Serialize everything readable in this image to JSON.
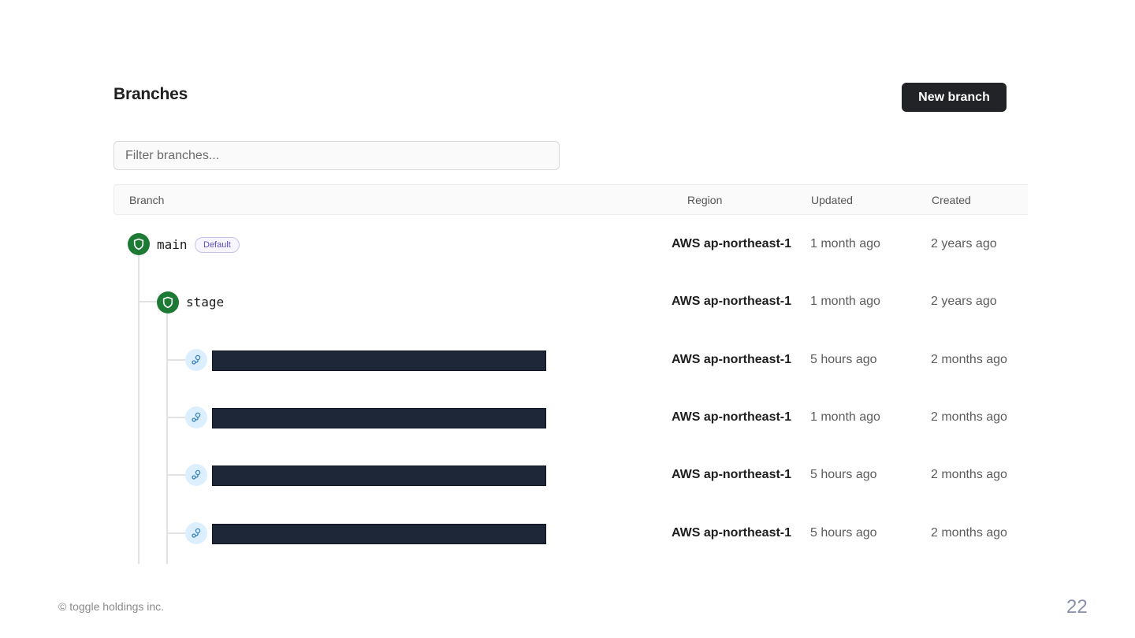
{
  "header": {
    "title": "Branches",
    "new_branch_label": "New branch"
  },
  "filter": {
    "placeholder": "Filter branches...",
    "value": ""
  },
  "table": {
    "columns": {
      "branch": "Branch",
      "region": "Region",
      "updated": "Updated",
      "created": "Created"
    },
    "rows": [
      {
        "name": "main",
        "badge": "Default",
        "icon": "shield-icon",
        "region": "AWS ap-northeast-1",
        "updated": "1 month ago",
        "created": "2 years ago"
      },
      {
        "name": "stage",
        "icon": "shield-icon",
        "region": "AWS ap-northeast-1",
        "updated": "1 month ago",
        "created": "2 years ago"
      },
      {
        "name_redacted": true,
        "icon": "branch-icon",
        "region": "AWS ap-northeast-1",
        "updated": "5 hours ago",
        "created": "2 months ago"
      },
      {
        "name_redacted": true,
        "icon": "branch-icon",
        "region": "AWS ap-northeast-1",
        "updated": "1 month ago",
        "created": "2 months ago"
      },
      {
        "name_redacted": true,
        "icon": "branch-icon",
        "region": "AWS ap-northeast-1",
        "updated": "5 hours ago",
        "created": "2 months ago"
      },
      {
        "name_redacted": true,
        "icon": "branch-icon",
        "region": "AWS ap-northeast-1",
        "updated": "5 hours ago",
        "created": "2 months ago"
      }
    ]
  },
  "footer": {
    "copyright": "© toggle holdings inc.",
    "page_number": "22"
  },
  "colors": {
    "primary_button": "#222326",
    "protected_icon": "#1d7a34",
    "branch_icon_bg": "#dcefff",
    "badge_text": "#5b4fc0",
    "redaction": "#1d2737"
  }
}
